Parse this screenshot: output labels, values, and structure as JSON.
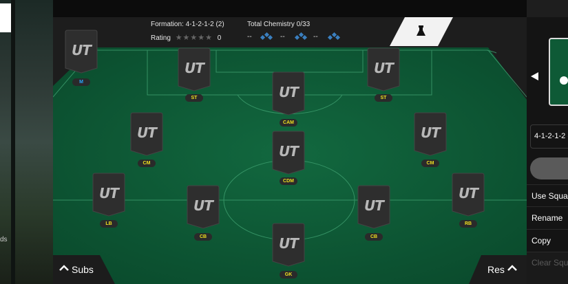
{
  "header": {
    "formation": "Formation: 4-1-2-1-2 (2)",
    "rating_label": "Rating",
    "rating_stars": "★★★★★",
    "rating_value": "0",
    "chemistry": "Total Chemistry 0/33",
    "chem_dash": "--"
  },
  "card_logo": "UT",
  "players": [
    {
      "pos": "M",
      "pos_color": "blue"
    },
    {
      "pos": "ST"
    },
    {
      "pos": "ST"
    },
    {
      "pos": "CAM"
    },
    {
      "pos": "CM"
    },
    {
      "pos": "CM"
    },
    {
      "pos": "CDM"
    },
    {
      "pos": "LB"
    },
    {
      "pos": "CB"
    },
    {
      "pos": "CB"
    },
    {
      "pos": "RB"
    },
    {
      "pos": "GK"
    }
  ],
  "footer": {
    "subs": "Subs",
    "res": "Res"
  },
  "left_panel": {
    "text": "ds"
  },
  "right_panel": {
    "formation_select": "4-1-2-1-2 (",
    "menu": [
      "Use Squad",
      "Rename",
      "Copy",
      "Clear Squad"
    ]
  },
  "colors": {
    "pitch": "#0f5a38",
    "position_text": "#f0e020",
    "manager_text": "#2aa6ff"
  }
}
